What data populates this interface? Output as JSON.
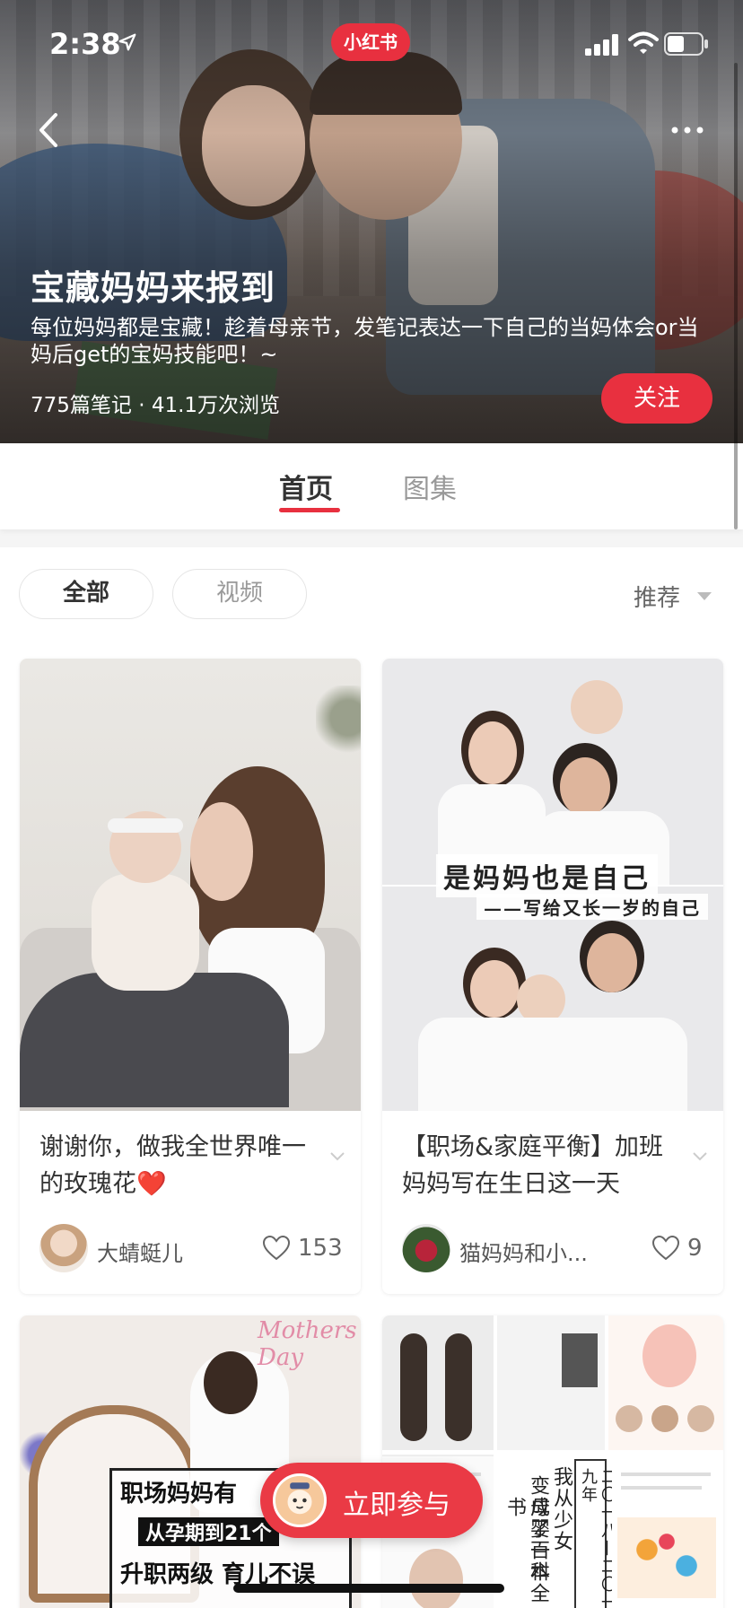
{
  "status_bar": {
    "time": "2:38",
    "app_badge": "小红书"
  },
  "hero": {
    "title": "宝藏妈妈来报到",
    "description": "每位妈妈都是宝藏！趁着母亲节，发笔记表达一下自己的当妈体会or当妈后get的宝妈技能吧！~",
    "stats": "775篇笔记 · 41.1万次浏览",
    "follow_label": "关注"
  },
  "tabs": [
    {
      "label": "首页",
      "active": true
    },
    {
      "label": "图集",
      "active": false
    }
  ],
  "filters": {
    "chips": [
      {
        "label": "全部",
        "selected": true
      },
      {
        "label": "视频",
        "selected": false
      }
    ],
    "sort_label": "推荐"
  },
  "cards": [
    {
      "title": "谢谢你，做我全世界唯一的玫瑰花❤️",
      "author": "大蜻蜓儿",
      "likes": "153"
    },
    {
      "title": "【职场&家庭平衡】加班妈妈写在生日这一天",
      "author": "猫妈妈和小...",
      "likes": "9",
      "poster_title": "是妈妈也是自己",
      "poster_subtitle": "——写给又长一岁的自己"
    },
    {
      "poster_script": "Mothers Day",
      "poster_line1": "职场妈妈有",
      "poster_line2": "从孕期到21个",
      "poster_line3": "升职两级 育儿不误"
    },
    {
      "poster_vertical_1": "我从少女",
      "poster_vertical_2": "变成了一本",
      "poster_vertical_3": "母婴百科全书",
      "poster_year": "二〇一八—二〇一九年"
    }
  ],
  "join_button": {
    "label": "立即参与"
  },
  "colors": {
    "brand_red": "#e8303f",
    "active_text": "#333333",
    "inactive_text": "#999999"
  }
}
